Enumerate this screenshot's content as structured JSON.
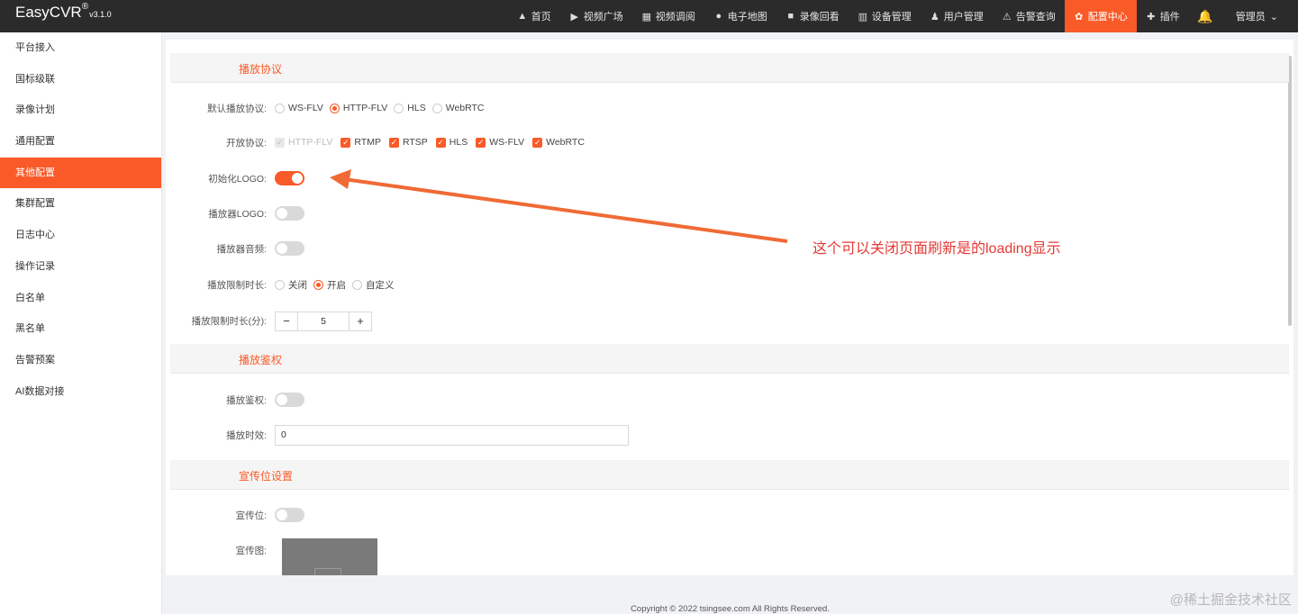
{
  "app": {
    "name": "EasyCVR",
    "reg": "®",
    "version": "v3.1.0"
  },
  "nav": [
    {
      "label": "首页",
      "icon": "dashboard-icon",
      "glyph": "▲",
      "active": false
    },
    {
      "label": "视频广场",
      "icon": "play-icon",
      "glyph": "▶",
      "active": false
    },
    {
      "label": "视频调阅",
      "icon": "video-grid-icon",
      "glyph": "▦",
      "active": false
    },
    {
      "label": "电子地图",
      "icon": "map-pin-icon",
      "glyph": "●",
      "active": false
    },
    {
      "label": "录像回看",
      "icon": "camera-icon",
      "glyph": "■",
      "active": false
    },
    {
      "label": "设备管理",
      "icon": "device-icon",
      "glyph": "▥",
      "active": false
    },
    {
      "label": "用户管理",
      "icon": "user-icon",
      "glyph": "♟",
      "active": false
    },
    {
      "label": "告警查询",
      "icon": "alarm-icon",
      "glyph": "⚠",
      "active": false
    },
    {
      "label": "配置中心",
      "icon": "gear-icon",
      "glyph": "✿",
      "active": true
    },
    {
      "label": "插件",
      "icon": "puzzle-icon",
      "glyph": "✚",
      "active": false
    }
  ],
  "user": {
    "label": "管理员",
    "caret": "⌄"
  },
  "sidebar": [
    {
      "label": "平台接入",
      "active": false
    },
    {
      "label": "国标级联",
      "active": false
    },
    {
      "label": "录像计划",
      "active": false
    },
    {
      "label": "通用配置",
      "active": false
    },
    {
      "label": "其他配置",
      "active": true
    },
    {
      "label": "集群配置",
      "active": false
    },
    {
      "label": "日志中心",
      "active": false
    },
    {
      "label": "操作记录",
      "active": false
    },
    {
      "label": "白名单",
      "active": false
    },
    {
      "label": "黑名单",
      "active": false
    },
    {
      "label": "告警预案",
      "active": false
    },
    {
      "label": "AI数据对接",
      "active": false
    }
  ],
  "sections": {
    "protocol": "播放协议",
    "auth": "播放鉴权",
    "promo": "宣传位设置"
  },
  "labels": {
    "default_protocol": "默认播放协议:",
    "open_protocol": "开放协议:",
    "init_logo": "初始化LOGO:",
    "player_logo": "播放器LOGO:",
    "player_audio": "播放器音频:",
    "play_limit": "播放限制时长:",
    "play_limit_minutes": "播放限制时长(分):",
    "auth": "播放鉴权:",
    "auth_ttl": "播放时效:",
    "promo": "宣传位:",
    "promo_image": "宣传图:"
  },
  "default_protocols": [
    {
      "label": "WS-FLV",
      "checked": false
    },
    {
      "label": "HTTP-FLV",
      "checked": true
    },
    {
      "label": "HLS",
      "checked": false
    },
    {
      "label": "WebRTC",
      "checked": false
    }
  ],
  "open_protocols": [
    {
      "label": "HTTP-FLV",
      "checked": true,
      "disabled": true
    },
    {
      "label": "RTMP",
      "checked": true,
      "disabled": false
    },
    {
      "label": "RTSP",
      "checked": true,
      "disabled": false
    },
    {
      "label": "HLS",
      "checked": true,
      "disabled": false
    },
    {
      "label": "WS-FLV",
      "checked": true,
      "disabled": false
    },
    {
      "label": "WebRTC",
      "checked": true,
      "disabled": false
    }
  ],
  "toggles": {
    "init_logo": true,
    "player_logo": false,
    "player_audio": false,
    "auth": false,
    "promo": false
  },
  "limit_options": [
    {
      "label": "关闭",
      "checked": false
    },
    {
      "label": "开启",
      "checked": true
    },
    {
      "label": "自定义",
      "checked": false
    }
  ],
  "stepper": {
    "minus": "−",
    "value": "5",
    "plus": "+"
  },
  "auth_ttl_value": "0",
  "annotation": "这个可以关闭页面刷新是的loading显示",
  "footer": "Copyright © 2022 tsingsee.com All Rights Reserved.",
  "watermark": "@稀土掘金技术社区",
  "colors": {
    "accent": "#fa5a28",
    "topbar": "#2b2b2b",
    "annotation": "#e53935"
  }
}
